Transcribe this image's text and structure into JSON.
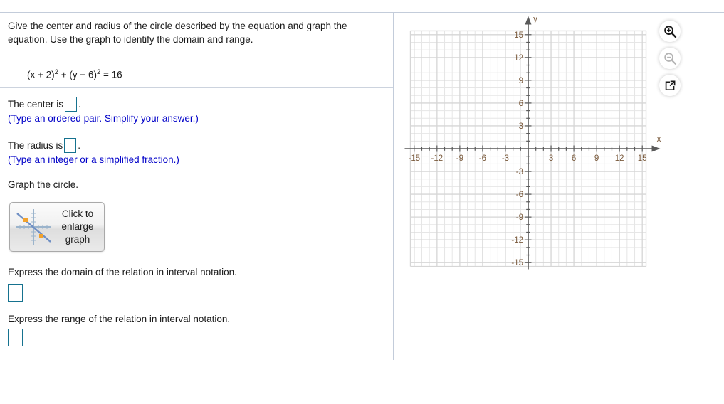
{
  "question": {
    "prompt": "Give the center and radius of the circle described by the equation and graph the equation. Use the graph to identify the domain and range.",
    "equation": {
      "lhs_first_base": "(x + 2)",
      "lhs_first_exp": "2",
      "plus": " + ",
      "lhs_second_base": "(y − 6)",
      "lhs_second_exp": "2",
      "equals": " = 16"
    },
    "center_label": "The center is",
    "center_period": ".",
    "center_hint": "(Type an ordered pair. Simplify your answer.)",
    "center_value": "",
    "radius_label": "The radius is",
    "radius_period": ".",
    "radius_hint": "(Type an integer or a simplified fraction.)",
    "radius_value": "",
    "graph_instruction": "Graph the circle.",
    "enlarge_button_label": "Click to enlarge graph",
    "domain_prompt": "Express the domain of the relation in interval notation.",
    "domain_value": "",
    "range_prompt": "Express the range of the relation in interval notation.",
    "range_value": ""
  },
  "tools": {
    "zoom_in": "zoom-in-icon",
    "zoom_out": "zoom-out-icon",
    "popout": "open-in-new-window-icon"
  },
  "chart_data": {
    "type": "scatter",
    "title": "",
    "xlabel": "x",
    "ylabel": "y",
    "xlim": [
      -16,
      16
    ],
    "ylim": [
      -16,
      16
    ],
    "grid": true,
    "minor_step": 1,
    "major_step": 3,
    "x_ticks": [
      -15,
      -12,
      -9,
      -6,
      -3,
      3,
      6,
      9,
      12,
      15
    ],
    "y_ticks": [
      15,
      12,
      9,
      6,
      3,
      -3,
      -6,
      -9,
      -12,
      -15
    ],
    "x_tick_labels": [
      "-15",
      "-12",
      "-9",
      "-6",
      "-3",
      "3",
      "6",
      "9",
      "12",
      "15"
    ],
    "y_tick_labels": [
      "15",
      "12",
      "9",
      "6",
      "3",
      "-3",
      "-6",
      "-9",
      "-12",
      "-15"
    ],
    "series": [],
    "legend": null,
    "annotations": [],
    "colors": {
      "grid_minor": "#e6e6e6",
      "grid_major": "#d6d6d6",
      "axis": "#5a5a5a",
      "tick_label": "#7a5a3c",
      "axis_label": "#7a5a3c"
    }
  }
}
